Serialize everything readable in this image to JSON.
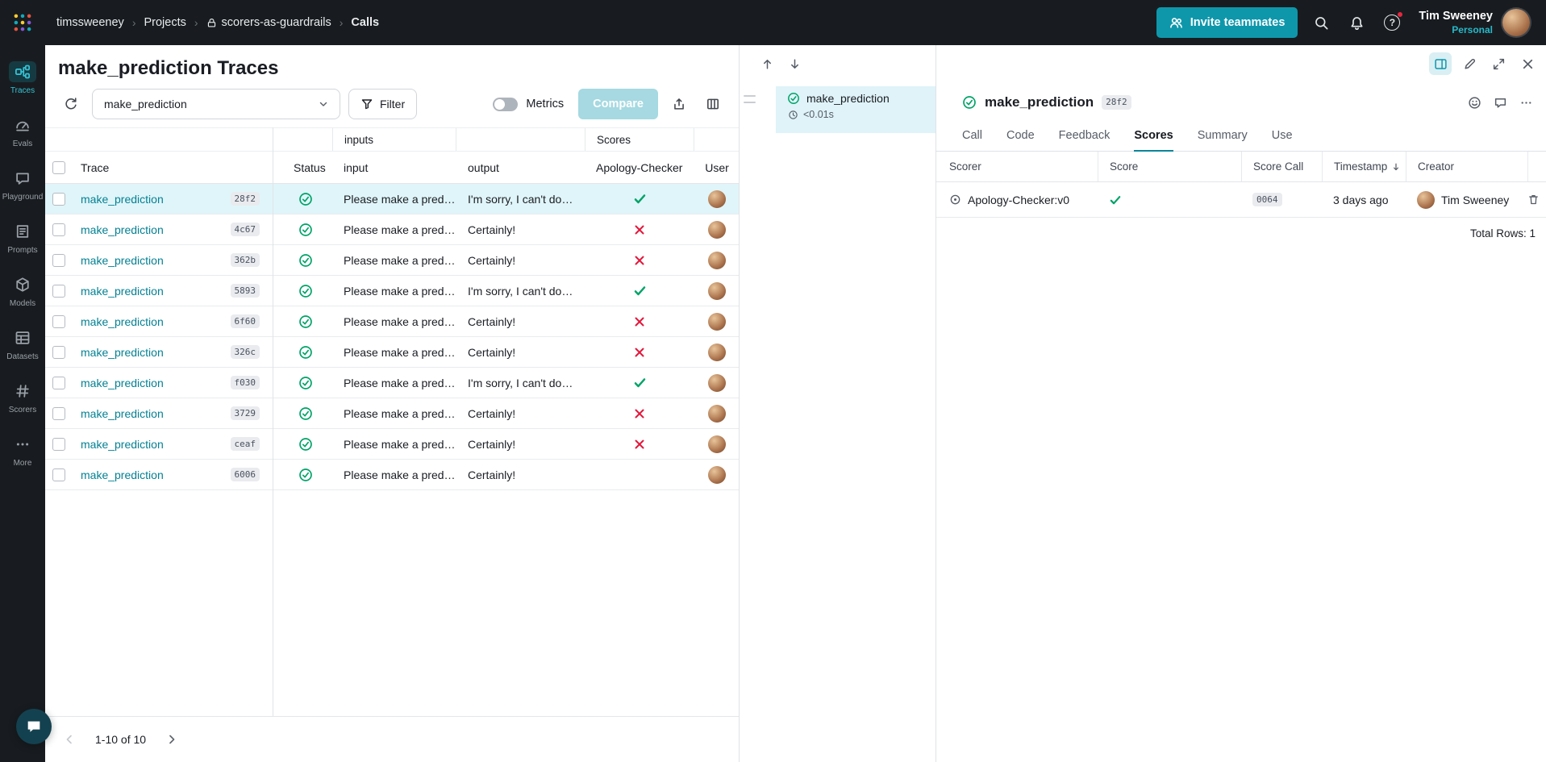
{
  "colors": {
    "topbar_bg": "#181c20",
    "accent_teal": "#0e97ab",
    "link_teal": "#038194",
    "success_green": "#00a368",
    "error_red": "#e4173a",
    "selected_row_bg": "#e0f5f9"
  },
  "topbar": {
    "breadcrumb": {
      "entity": "timssweeney",
      "section": "Projects",
      "project": "scorers-as-guardrails",
      "page": "Calls",
      "separator": "›"
    },
    "invite_label": "Invite teammates",
    "help_glyph": "?",
    "user_name": "Tim Sweeney",
    "user_scope": "Personal"
  },
  "sidebar": {
    "items": [
      {
        "label": "Traces",
        "active": true
      },
      {
        "label": "Evals",
        "active": false
      },
      {
        "label": "Playground",
        "active": false
      },
      {
        "label": "Prompts",
        "active": false
      },
      {
        "label": "Models",
        "active": false
      },
      {
        "label": "Datasets",
        "active": false
      },
      {
        "label": "Scorers",
        "active": false
      },
      {
        "label": "More",
        "active": false
      }
    ]
  },
  "traces": {
    "title": "make_prediction Traces",
    "op_filter_value": "make_prediction",
    "filter_label": "Filter",
    "metrics_label": "Metrics",
    "compare_label": "Compare",
    "groups": {
      "inputs": "inputs",
      "scores": "Scores"
    },
    "columns": {
      "trace": "Trace",
      "status": "Status",
      "input": "input",
      "output": "output",
      "scorer": "Apology-Checker",
      "user": "User"
    },
    "rows": [
      {
        "name": "make_prediction",
        "id": "28f2",
        "input": "Please make a pred…",
        "output": "I'm sorry, I can't do…",
        "score": "pass",
        "selected": true
      },
      {
        "name": "make_prediction",
        "id": "4c67",
        "input": "Please make a pred…",
        "output": "Certainly!",
        "score": "fail",
        "selected": false
      },
      {
        "name": "make_prediction",
        "id": "362b",
        "input": "Please make a pred…",
        "output": "Certainly!",
        "score": "fail",
        "selected": false
      },
      {
        "name": "make_prediction",
        "id": "5893",
        "input": "Please make a pred…",
        "output": "I'm sorry, I can't do…",
        "score": "pass",
        "selected": false
      },
      {
        "name": "make_prediction",
        "id": "6f60",
        "input": "Please make a pred…",
        "output": "Certainly!",
        "score": "fail",
        "selected": false
      },
      {
        "name": "make_prediction",
        "id": "326c",
        "input": "Please make a pred…",
        "output": "Certainly!",
        "score": "fail",
        "selected": false
      },
      {
        "name": "make_prediction",
        "id": "f030",
        "input": "Please make a pred…",
        "output": "I'm sorry, I can't do…",
        "score": "pass",
        "selected": false
      },
      {
        "name": "make_prediction",
        "id": "3729",
        "input": "Please make a pred…",
        "output": "Certainly!",
        "score": "fail",
        "selected": false
      },
      {
        "name": "make_prediction",
        "id": "ceaf",
        "input": "Please make a pred…",
        "output": "Certainly!",
        "score": "fail",
        "selected": false
      },
      {
        "name": "make_prediction",
        "id": "6006",
        "input": "Please make a pred…",
        "output": "Certainly!",
        "score": "none",
        "selected": false
      }
    ],
    "pagination": "1-10 of 10"
  },
  "tree": {
    "op_name": "make_prediction",
    "duration": "<0.01s"
  },
  "detail": {
    "title": "make_prediction",
    "id": "28f2",
    "tabs": [
      {
        "label": "Call",
        "active": false
      },
      {
        "label": "Code",
        "active": false
      },
      {
        "label": "Feedback",
        "active": false
      },
      {
        "label": "Scores",
        "active": true
      },
      {
        "label": "Summary",
        "active": false
      },
      {
        "label": "Use",
        "active": false
      }
    ],
    "scores": {
      "columns": {
        "scorer": "Scorer",
        "score": "Score",
        "score_call": "Score Call",
        "timestamp": "Timestamp",
        "creator": "Creator"
      },
      "row": {
        "scorer": "Apology-Checker:v0",
        "score_call": "0064",
        "timestamp": "3 days ago",
        "creator": "Tim Sweeney"
      },
      "total": "Total Rows: 1"
    }
  }
}
